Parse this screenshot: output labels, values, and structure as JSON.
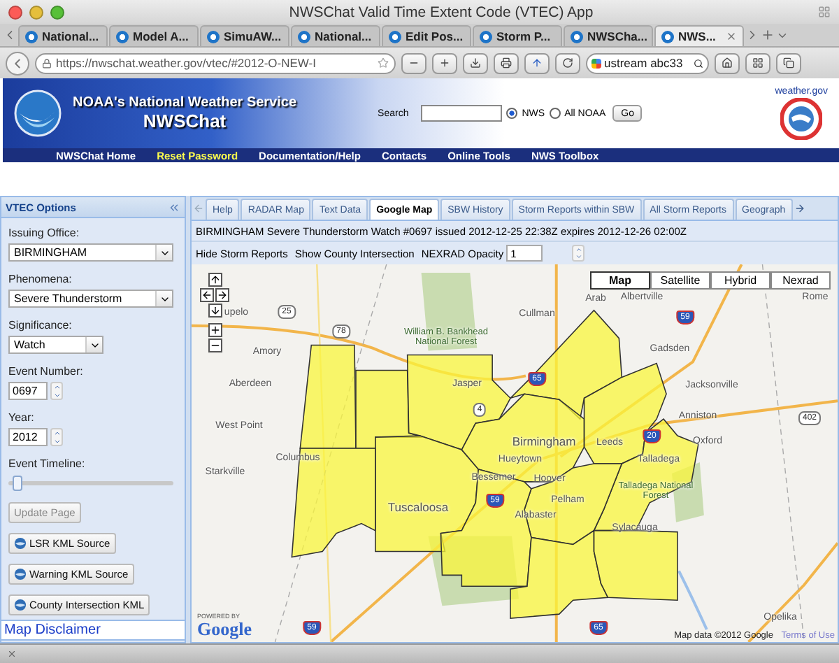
{
  "window": {
    "title": "NWSChat Valid Time Extent Code (VTEC) App"
  },
  "browser_tabs": [
    {
      "label": "National...",
      "selected": false
    },
    {
      "label": "Model A...",
      "selected": false
    },
    {
      "label": "SimuAW...",
      "selected": false
    },
    {
      "label": "National...",
      "selected": false
    },
    {
      "label": "Edit Pos...",
      "selected": false
    },
    {
      "label": "Storm P...",
      "selected": false
    },
    {
      "label": "NWSCha...",
      "selected": false
    },
    {
      "label": "NWS...",
      "selected": true
    }
  ],
  "address_bar": {
    "url": "https://nwschat.weather.gov/vtec/#2012-O-NEW-I"
  },
  "search_bar": {
    "value": "ustream abc33"
  },
  "header": {
    "title": "NOAA's National Weather Service",
    "subtitle": "NWSChat",
    "search_label": "Search",
    "scope_options": [
      {
        "label": "NWS",
        "selected": true
      },
      {
        "label": "All NOAA",
        "selected": false
      }
    ],
    "go_button": "Go",
    "site_label": "weather.gov"
  },
  "nav": [
    {
      "label": "NWSChat Home",
      "selected": false
    },
    {
      "label": "Reset Password",
      "selected": true
    },
    {
      "label": "Documentation/Help",
      "selected": false
    },
    {
      "label": "Contacts",
      "selected": false
    },
    {
      "label": "Online Tools",
      "selected": false
    },
    {
      "label": "NWS Toolbox",
      "selected": false
    }
  ],
  "sidebar": {
    "title": "VTEC Options",
    "fields": [
      {
        "kind": "select",
        "label": "Issuing Office:",
        "value": "BIRMINGHAM"
      },
      {
        "kind": "select",
        "label": "Phenomena:",
        "value": "Severe Thunderstorm"
      },
      {
        "kind": "compact",
        "label": "Significance:",
        "value": "Watch"
      },
      {
        "kind": "spinner",
        "label": "Event Number:",
        "value": "0697"
      },
      {
        "kind": "spinner",
        "label": "Year:",
        "value": "2012"
      },
      {
        "kind": "slider",
        "label": "Event Timeline:",
        "level": 0.03
      }
    ],
    "buttons": [
      {
        "label": "Update Page",
        "kind": "plain",
        "disabled": true
      },
      {
        "label": "LSR KML Source",
        "kind": "globe",
        "disabled": false
      },
      {
        "label": "Warning KML Source",
        "kind": "globe",
        "disabled": false
      },
      {
        "label": "County Intersection KML",
        "kind": "globe",
        "disabled": false
      }
    ],
    "link": "Map Disclaimer"
  },
  "tabs": [
    {
      "label": "Help",
      "selected": false
    },
    {
      "label": "RADAR Map",
      "selected": false
    },
    {
      "label": "Text Data",
      "selected": false
    },
    {
      "label": "Google Map",
      "selected": true
    },
    {
      "label": "SBW History",
      "selected": false
    },
    {
      "label": "Storm Reports within SBW",
      "selected": false
    },
    {
      "label": "All Storm Reports",
      "selected": false
    },
    {
      "label": "Geograph",
      "selected": false
    }
  ],
  "event_summary": "BIRMINGHAM Severe Thunderstorm Watch #0697 issued 2012-12-25 22:38Z expires 2012-12-26 02:00Z",
  "map_controls": {
    "toggles": [
      "Hide Storm Reports",
      "Show County Intersection"
    ],
    "opacity_label": "NEXRAD Opacity",
    "opacity_value": "1"
  },
  "map": {
    "types": [
      {
        "label": "Map",
        "selected": true
      },
      {
        "label": "Satellite",
        "selected": false
      },
      {
        "label": "Hybrid",
        "selected": false
      },
      {
        "label": "Nexrad",
        "selected": false
      }
    ],
    "labels": [
      {
        "text": "Arab",
        "kind": "city"
      },
      {
        "text": "Albertville",
        "kind": "city"
      },
      {
        "text": "Rome",
        "kind": "city"
      },
      {
        "text": "upelo",
        "kind": "city"
      },
      {
        "text": "25",
        "kind": "highway"
      },
      {
        "text": "Cullman",
        "kind": "city"
      },
      {
        "text": "59",
        "kind": "interstate"
      },
      {
        "text": "78",
        "kind": "highway"
      },
      {
        "text": "William B. Bankhead National Forest",
        "kind": "park"
      },
      {
        "text": "Amory",
        "kind": "city"
      },
      {
        "text": "Gadsden",
        "kind": "city"
      },
      {
        "text": "65",
        "kind": "interstate"
      },
      {
        "text": "Aberdeen",
        "kind": "city"
      },
      {
        "text": "Jasper",
        "kind": "city"
      },
      {
        "text": "Jacksonville",
        "kind": "city"
      },
      {
        "text": "4",
        "kind": "highway"
      },
      {
        "text": "Anniston",
        "kind": "city"
      },
      {
        "text": "402",
        "kind": "highway"
      },
      {
        "text": "West Point",
        "kind": "city"
      },
      {
        "text": "20",
        "kind": "interstate"
      },
      {
        "text": "Birmingham",
        "kind": "major"
      },
      {
        "text": "Leeds",
        "kind": "city"
      },
      {
        "text": "Oxford",
        "kind": "city"
      },
      {
        "text": "Columbus",
        "kind": "city"
      },
      {
        "text": "Hueytown",
        "kind": "city"
      },
      {
        "text": "Talladega",
        "kind": "city"
      },
      {
        "text": "Starkville",
        "kind": "city"
      },
      {
        "text": "Bessemer",
        "kind": "city"
      },
      {
        "text": "Hoover",
        "kind": "city"
      },
      {
        "text": "Talladega National Forest",
        "kind": "park"
      },
      {
        "text": "59",
        "kind": "interstate"
      },
      {
        "text": "Pelham",
        "kind": "city"
      },
      {
        "text": "Tuscaloosa",
        "kind": "major"
      },
      {
        "text": "Alabaster",
        "kind": "city"
      },
      {
        "text": "Sylacauga",
        "kind": "city"
      },
      {
        "text": "Opelika",
        "kind": "city"
      },
      {
        "text": "59",
        "kind": "interstate"
      },
      {
        "text": "65",
        "kind": "interstate"
      }
    ],
    "powered_by": "POWERED BY",
    "logo": "Google",
    "attribution": "Map data ©2012 Google",
    "terms": "Terms of Use"
  }
}
